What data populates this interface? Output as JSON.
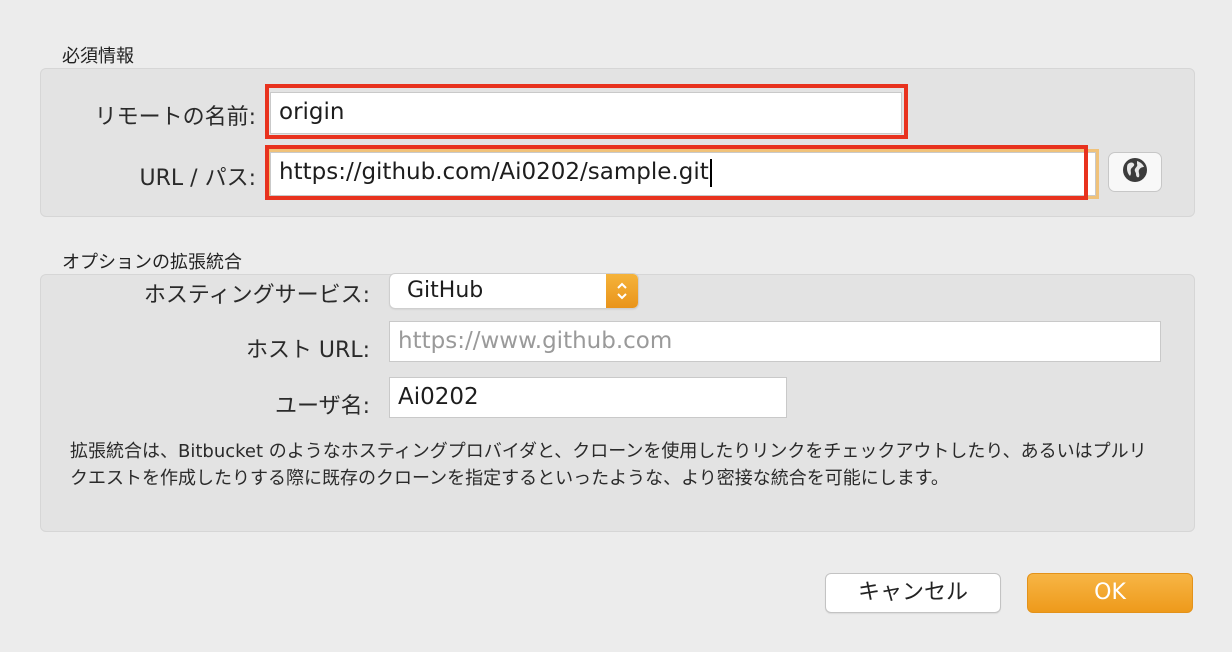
{
  "required_section": {
    "title": "必須情報",
    "remote_name_label": "リモートの名前:",
    "remote_name_value": "origin",
    "url_label": "URL / パス:",
    "url_value": "https://github.com/Ai0202/sample.git",
    "browse_icon": "globe-icon"
  },
  "options_section": {
    "title": "オプションの拡張統合",
    "hosting_label": "ホスティングサービス:",
    "hosting_value": "GitHub",
    "host_url_label": "ホスト URL:",
    "host_url_placeholder": "https://www.github.com",
    "username_label": "ユーザ名:",
    "username_value": "Ai0202",
    "description": "拡張統合は、Bitbucket のようなホスティングプロバイダと、クローンを使用したりリンクをチェックアウトしたり、あるいはプルリクエストを作成したりする際に既存のクローンを指定するといったような、より密接な統合を可能にします。"
  },
  "buttons": {
    "cancel_label": "キャンセル",
    "ok_label": "OK"
  },
  "colors": {
    "accent": "#ee9a1b",
    "highlight": "#e8321e"
  }
}
